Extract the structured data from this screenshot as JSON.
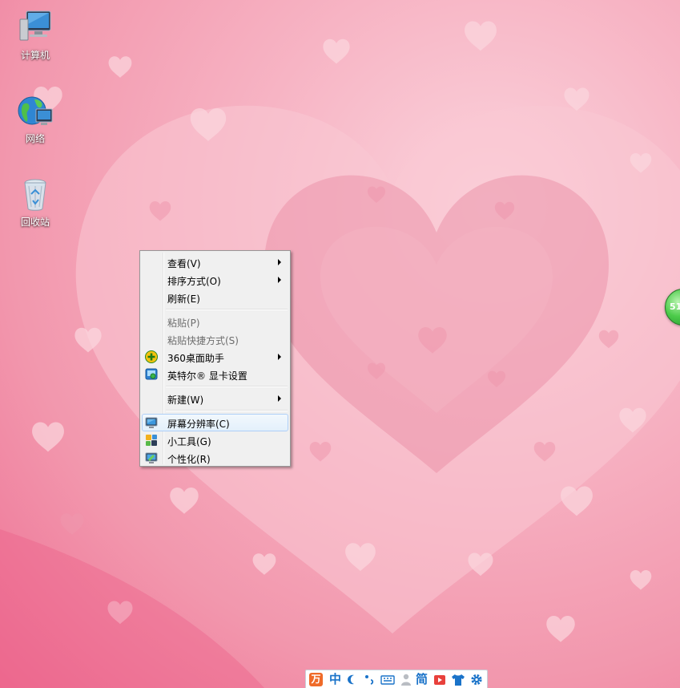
{
  "desktop": {
    "icons": [
      {
        "label": "计算机",
        "icon": "computer-icon"
      },
      {
        "label": "网络",
        "icon": "network-icon"
      },
      {
        "label": "回收站",
        "icon": "recycle-bin-icon"
      }
    ],
    "edge_widget": {
      "text": "51"
    }
  },
  "context_menu": {
    "items": [
      {
        "label": "查看(V)",
        "submenu": true
      },
      {
        "label": "排序方式(O)",
        "submenu": true
      },
      {
        "label": "刷新(E)"
      },
      {
        "label": "粘贴(P)",
        "disabled": true
      },
      {
        "label": "粘贴快捷方式(S)",
        "disabled": true
      },
      {
        "label": "360桌面助手",
        "submenu": true,
        "icon": "360-assistant-icon"
      },
      {
        "label": "英特尔® 显卡设置",
        "icon": "intel-graphics-icon"
      },
      {
        "label": "新建(W)",
        "submenu": true
      },
      {
        "label": "屏幕分辨率(C)",
        "icon": "screen-resolution-icon",
        "highlighted": true
      },
      {
        "label": "小工具(G)",
        "icon": "gadgets-icon"
      },
      {
        "label": "个性化(R)",
        "icon": "personalize-icon"
      }
    ]
  },
  "ime_toolbar": {
    "logo": "万",
    "mode": "中",
    "script": "简"
  },
  "colors": {
    "wallpaper": "#f7b4c4",
    "menu_bg": "#f0f0f0",
    "highlight_border": "#aecff7",
    "ime_blue": "#1a73c9",
    "ime_logo": "#ef6b29"
  }
}
